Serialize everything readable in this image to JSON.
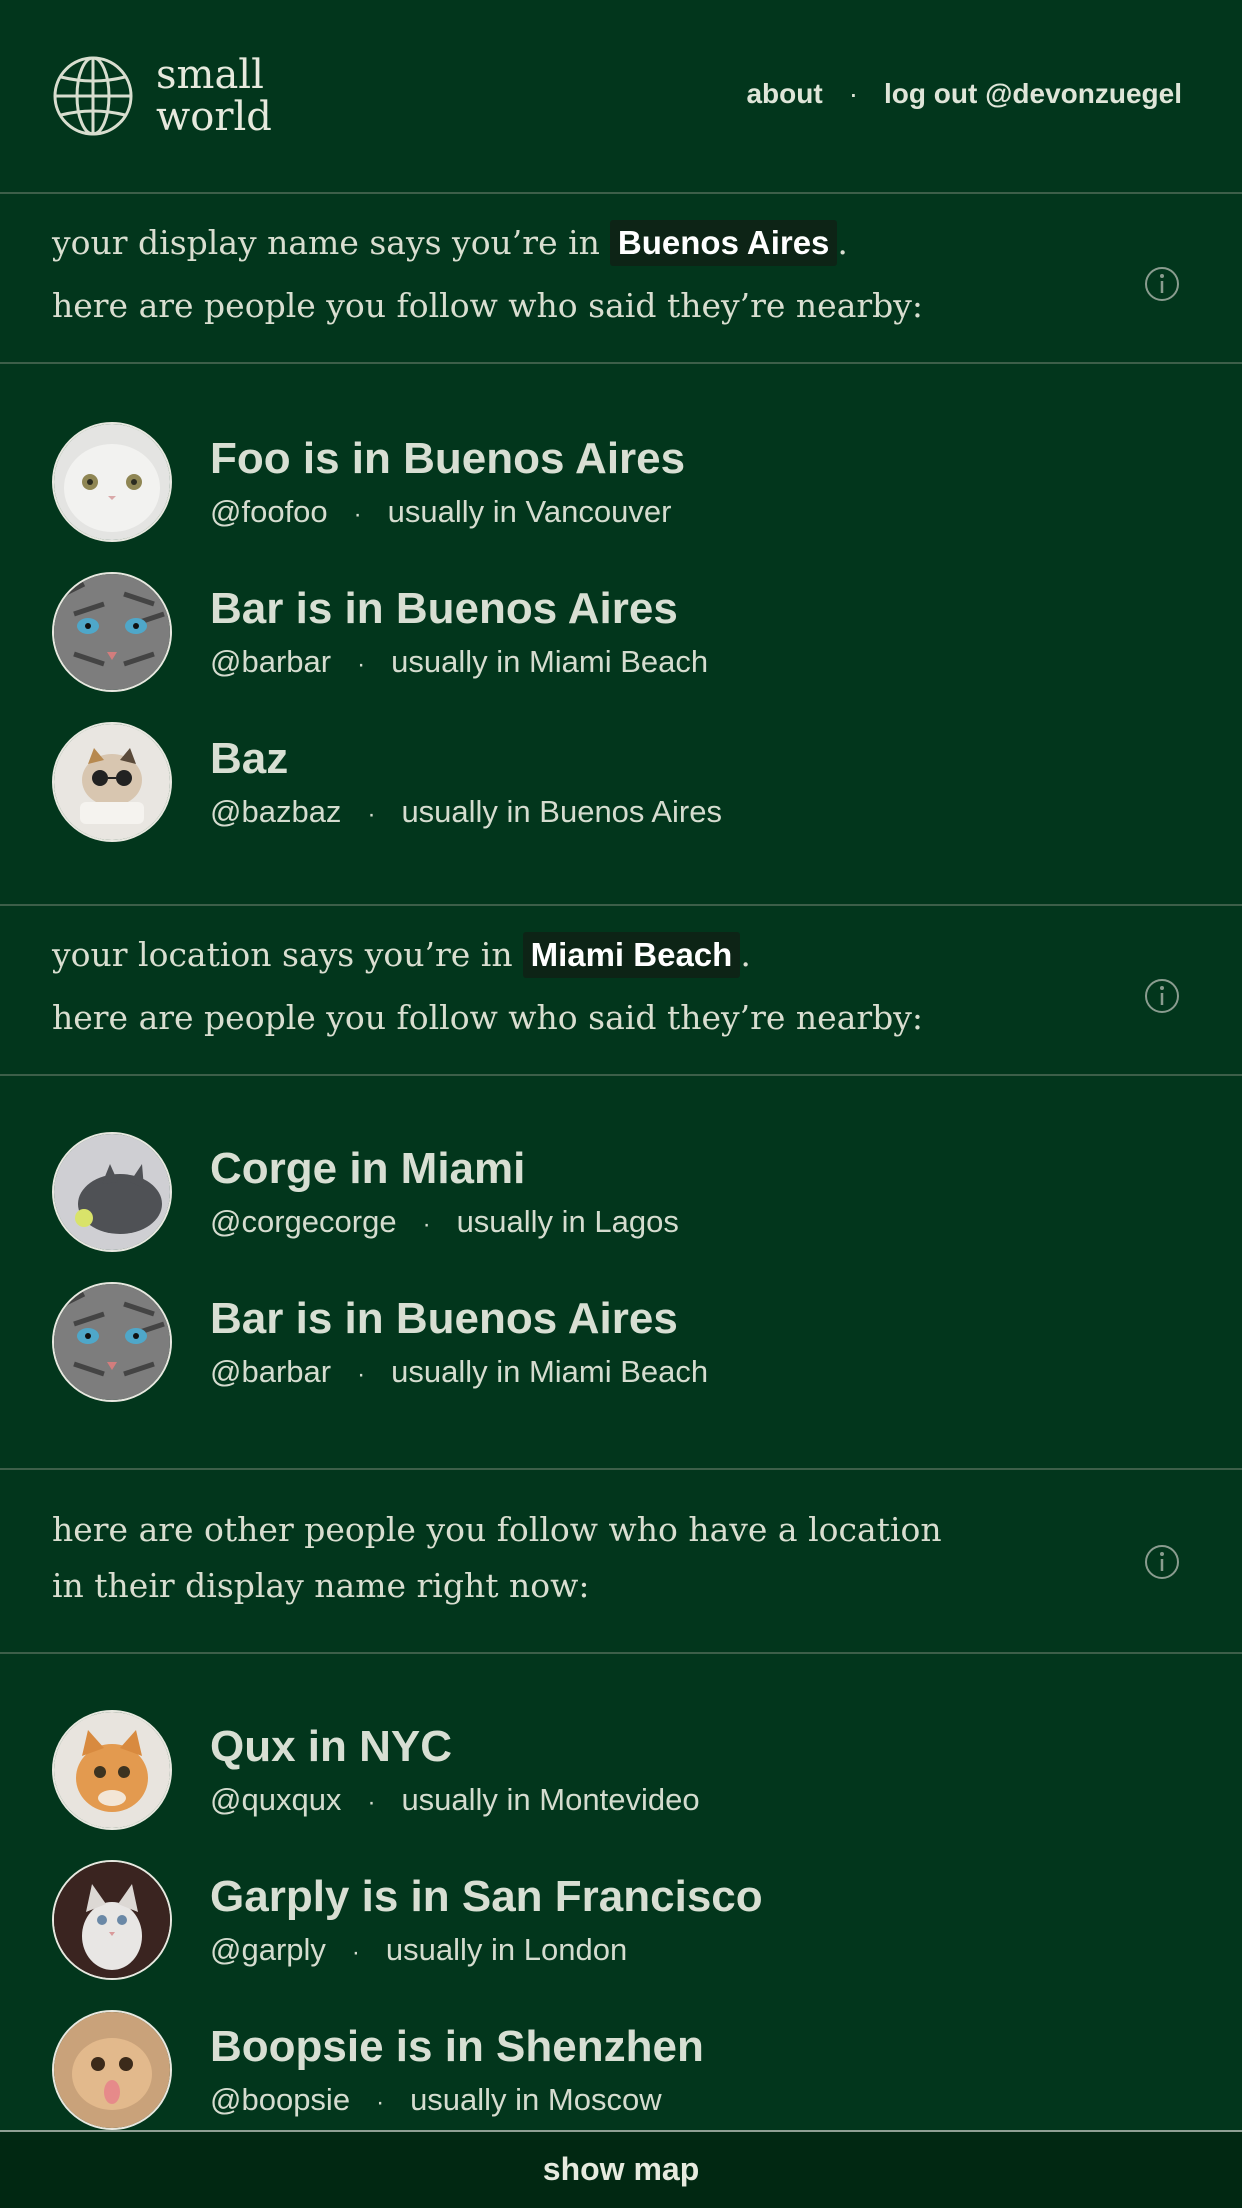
{
  "header": {
    "logo_line1": "small",
    "logo_line2": "world",
    "nav_about": "about",
    "nav_sep": "·",
    "nav_logout": "log out @devonzuegel"
  },
  "section1": {
    "line1_pre": "your display name says you’re in",
    "place": "Buenos Aires",
    "line1_post": ".",
    "line2": "here are people you follow who said they’re nearby:"
  },
  "section1_people": [
    {
      "name": "Foo is in Buenos Aires",
      "handle": "@foofoo",
      "usual": "usually in Vancouver"
    },
    {
      "name": "Bar is in Buenos Aires",
      "handle": "@barbar",
      "usual": "usually in Miami Beach"
    },
    {
      "name": "Baz",
      "handle": "@bazbaz",
      "usual": "usually in Buenos Aires"
    }
  ],
  "section2": {
    "line1_pre": "your location says you’re in",
    "place": "Miami Beach",
    "line1_post": ".",
    "line2": "here are people you follow who said they’re nearby:"
  },
  "section2_people": [
    {
      "name": "Corge in Miami",
      "handle": "@corgecorge",
      "usual": "usually in Lagos"
    },
    {
      "name": "Bar is in Buenos Aires",
      "handle": "@barbar",
      "usual": "usually in Miami Beach"
    }
  ],
  "section3": {
    "line1": "here are other people you follow who have a location",
    "line2": "in their display name right now:"
  },
  "section3_people": [
    {
      "name": "Qux in NYC",
      "handle": "@quxqux",
      "usual": "usually in Montevideo"
    },
    {
      "name": "Garply is in San Francisco",
      "handle": "@garply",
      "usual": "usually in London"
    },
    {
      "name": "Boopsie is in Shenzhen",
      "handle": "@boopsie",
      "usual": "usually in Moscow"
    }
  ],
  "separator": "·",
  "footer": {
    "show_map": "show map"
  },
  "colors": {
    "background": "#02361c",
    "pill": "#0d2416",
    "footer": "#012812"
  },
  "icons": [
    "globe-icon",
    "info-icon"
  ]
}
